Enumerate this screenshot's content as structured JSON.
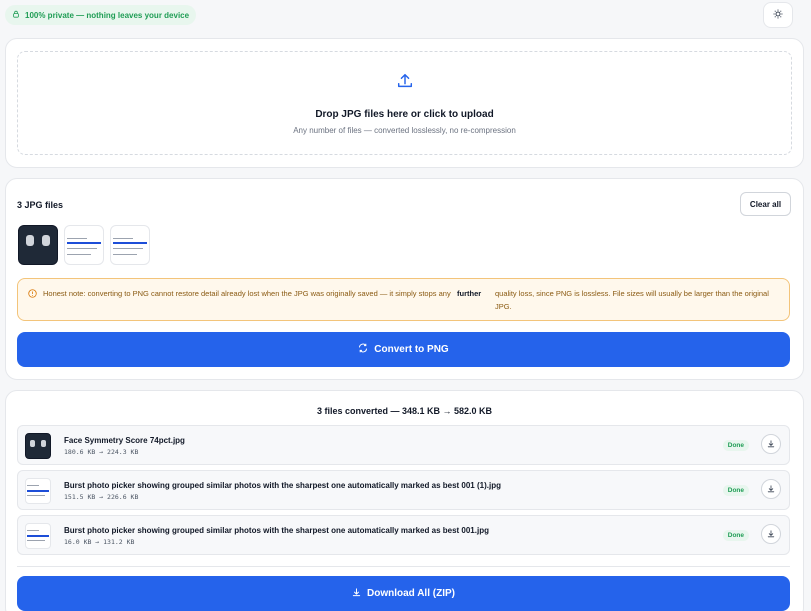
{
  "header": {
    "privacy_label": "100% private — nothing leaves your device",
    "privacy_icon": "lock-icon",
    "theme_icon": "sun-icon"
  },
  "upload": {
    "icon": "upload-icon",
    "title": "Drop JPG files here or click to upload",
    "subtitle": "Any number of files — converted losslessly, no re-compression"
  },
  "files": {
    "title": "3 JPG files",
    "clear_label": "Clear all",
    "note_part1": "Honest note: converting to PNG cannot restore detail already lost when the JPG was originally saved — it simply stops any",
    "note_emphasis": "further",
    "note_part2": "quality loss, since PNG is lossless. File sizes will usually be larger than the original JPG.",
    "convert_label": "Convert to PNG"
  },
  "results": {
    "title": "3 files converted — 348.1 KB → 582.0 KB",
    "rows": [
      {
        "name": "Face Symmetry Score 74pct.jpg",
        "size": "180.6 KB → 224.3 KB",
        "status": "Done"
      },
      {
        "name": "Burst photo picker showing grouped similar photos with the sharpest one automatically marked as best 001 (1).jpg",
        "size": "151.5 KB → 226.6 KB",
        "status": "Done"
      },
      {
        "name": "Burst photo picker showing grouped similar photos with the sharpest one automatically marked as best 001.jpg",
        "size": "16.0 KB → 131.2 KB",
        "status": "Done"
      }
    ],
    "download_all_label": "Download All (ZIP)"
  },
  "colors": {
    "accent": "#2563eb",
    "success": "#1f9d55",
    "warning_border": "#f3c47a",
    "warning_bg": "#fff8ec"
  }
}
